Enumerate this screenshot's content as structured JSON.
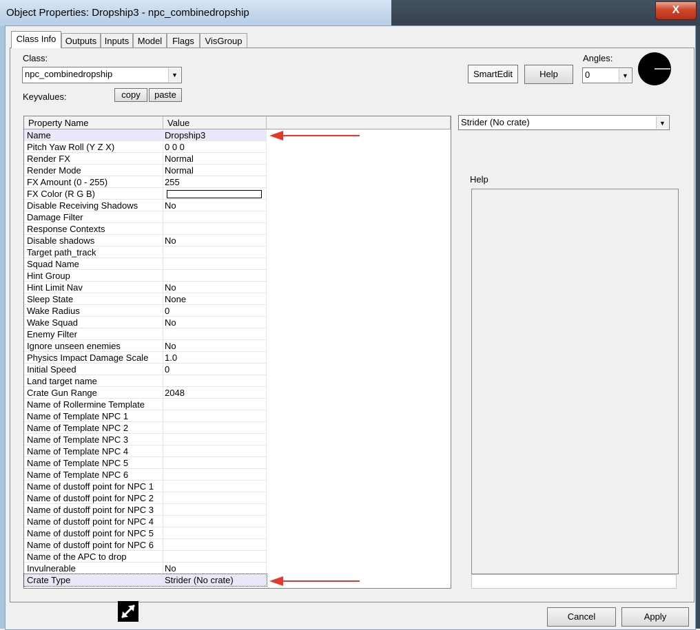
{
  "window": {
    "title": "Object Properties: Dropship3 - npc_combinedropship",
    "close_glyph": "X"
  },
  "tabs": [
    {
      "label": "Class Info",
      "active": true
    },
    {
      "label": "Outputs"
    },
    {
      "label": "Inputs"
    },
    {
      "label": "Model"
    },
    {
      "label": "Flags"
    },
    {
      "label": "VisGroup"
    }
  ],
  "class_section": {
    "class_label": "Class:",
    "class_value": "npc_combinedropship",
    "keyvalues_label": "Keyvalues:",
    "copy_label": "copy",
    "paste_label": "paste"
  },
  "top_right": {
    "smartedit_label": "SmartEdit",
    "help_label": "Help",
    "angles_label": "Angles:",
    "angles_value": "0"
  },
  "grid": {
    "columns": [
      "Property Name",
      "Value"
    ],
    "rows": [
      {
        "name": "Name",
        "value": "Dropship3"
      },
      {
        "name": "Pitch Yaw Roll (Y Z X)",
        "value": "0 0 0"
      },
      {
        "name": "Render FX",
        "value": "Normal"
      },
      {
        "name": "Render Mode",
        "value": "Normal"
      },
      {
        "name": "FX Amount (0 - 255)",
        "value": "255"
      },
      {
        "name": "FX Color (R G B)",
        "value": ""
      },
      {
        "name": "Disable Receiving Shadows",
        "value": "No"
      },
      {
        "name": "Damage Filter",
        "value": ""
      },
      {
        "name": "Response Contexts",
        "value": ""
      },
      {
        "name": "Disable shadows",
        "value": "No"
      },
      {
        "name": "Target path_track",
        "value": ""
      },
      {
        "name": "Squad Name",
        "value": ""
      },
      {
        "name": "Hint Group",
        "value": ""
      },
      {
        "name": "Hint Limit Nav",
        "value": "No"
      },
      {
        "name": "Sleep State",
        "value": "None"
      },
      {
        "name": "Wake Radius",
        "value": "0"
      },
      {
        "name": "Wake Squad",
        "value": "No"
      },
      {
        "name": "Enemy Filter",
        "value": ""
      },
      {
        "name": "Ignore unseen enemies",
        "value": "No"
      },
      {
        "name": "Physics Impact Damage Scale",
        "value": "1.0"
      },
      {
        "name": "Initial Speed",
        "value": "0"
      },
      {
        "name": "Land target name",
        "value": ""
      },
      {
        "name": "Crate Gun Range",
        "value": "2048"
      },
      {
        "name": "Name of Rollermine Template",
        "value": ""
      },
      {
        "name": "Name of Template NPC 1",
        "value": ""
      },
      {
        "name": "Name of Template NPC 2",
        "value": ""
      },
      {
        "name": "Name of Template NPC 3",
        "value": ""
      },
      {
        "name": "Name of Template NPC 4",
        "value": ""
      },
      {
        "name": "Name of Template NPC 5",
        "value": ""
      },
      {
        "name": "Name of Template NPC 6",
        "value": ""
      },
      {
        "name": "Name of dustoff point for NPC 1",
        "value": ""
      },
      {
        "name": "Name of dustoff point for NPC 2",
        "value": ""
      },
      {
        "name": "Name of dustoff point for NPC 3",
        "value": ""
      },
      {
        "name": "Name of dustoff point for NPC 4",
        "value": ""
      },
      {
        "name": "Name of dustoff point for NPC 5",
        "value": ""
      },
      {
        "name": "Name of dustoff point for NPC 6",
        "value": ""
      },
      {
        "name": "Name of the APC to drop",
        "value": ""
      },
      {
        "name": "Invulnerable",
        "value": "No"
      },
      {
        "name": "Crate Type",
        "value": "Strider (No crate)"
      }
    ]
  },
  "value_editor": {
    "value": "Strider (No crate)"
  },
  "help_panel": {
    "label": "Help"
  },
  "bottom": {
    "cancel_label": "Cancel",
    "apply_label": "Apply"
  },
  "colors": {
    "annotation_arrow": "#e5372b",
    "selected_row": "#e8e8f8"
  }
}
